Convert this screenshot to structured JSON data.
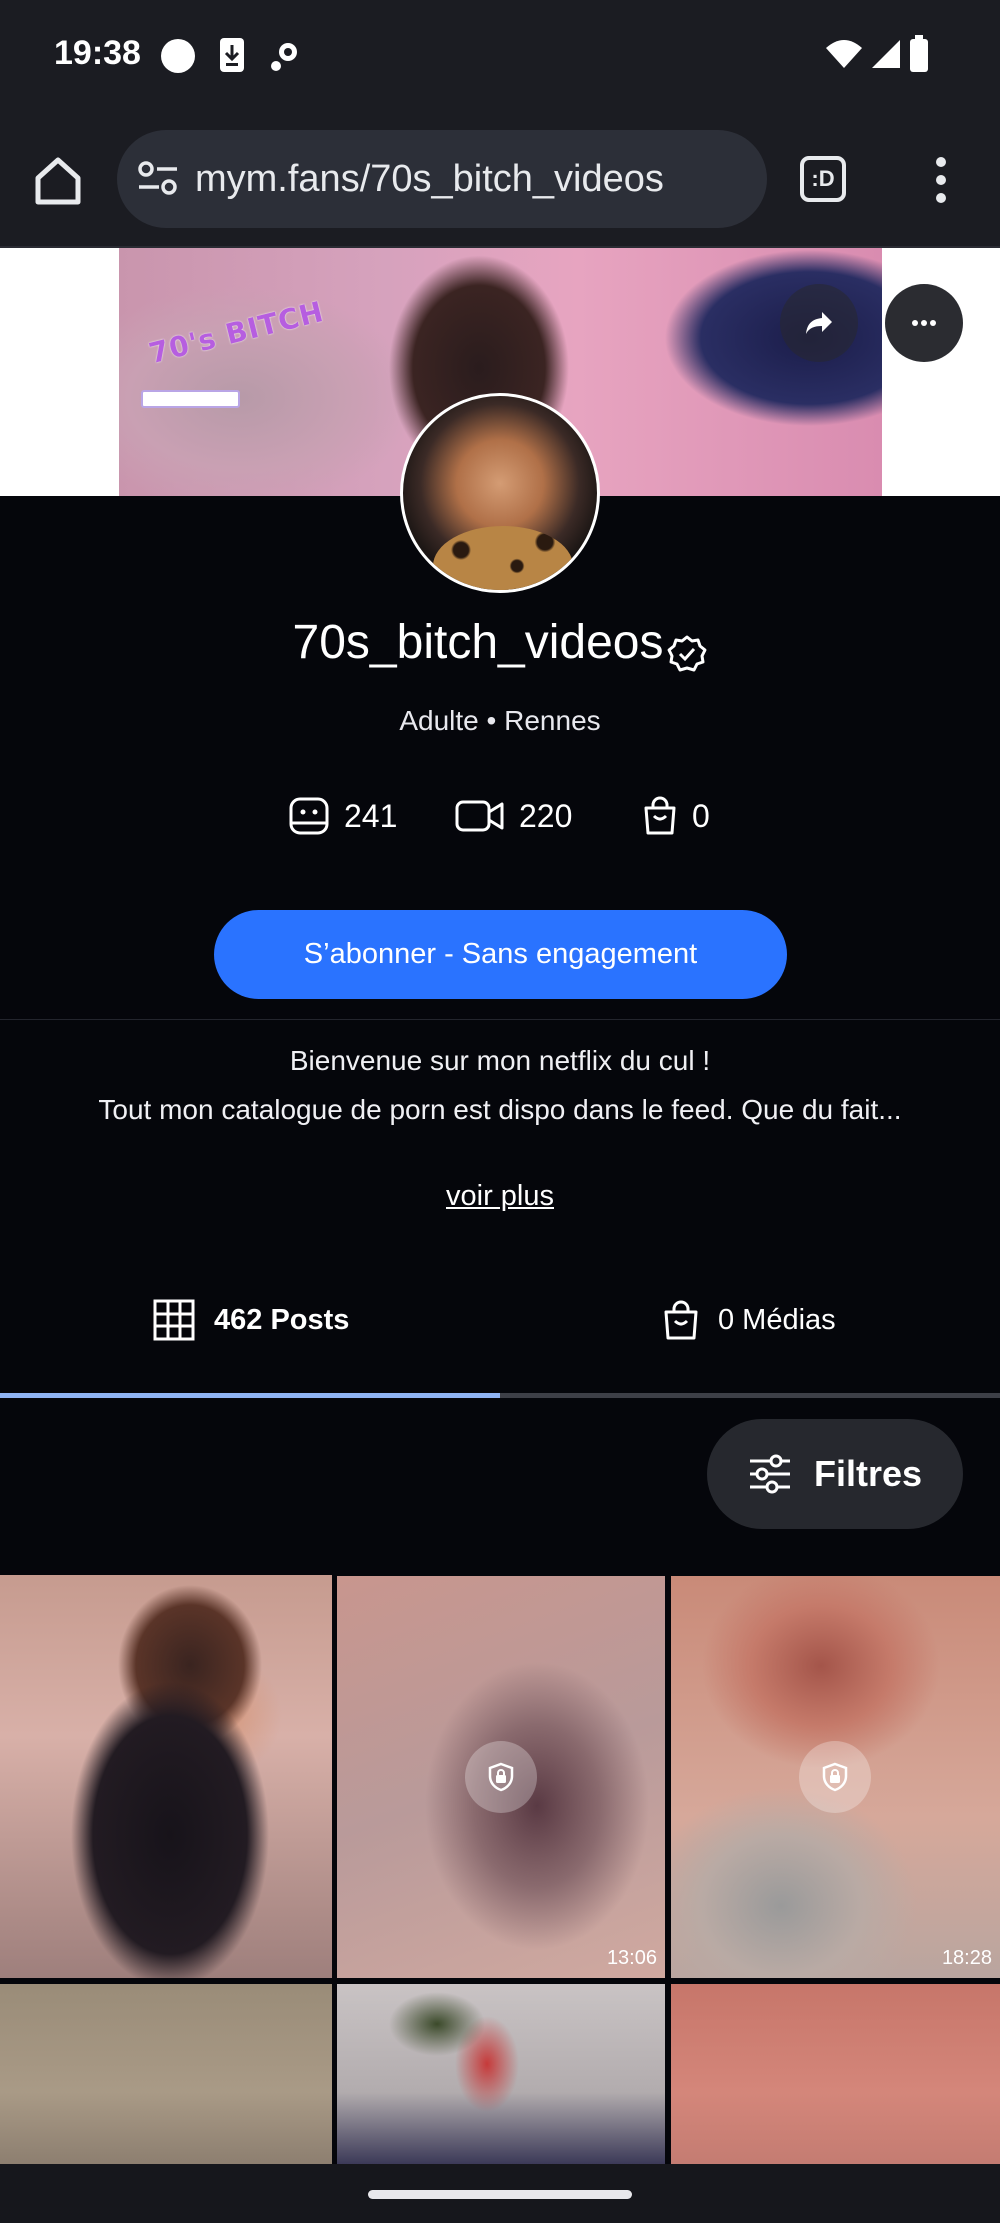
{
  "status_bar": {
    "time": "19:38"
  },
  "browser": {
    "url": "mym.fans/70s_bitch_videos",
    "tabs_label": ":D"
  },
  "banner": {
    "logo_text": "70's BITCH"
  },
  "profile": {
    "username": "70s_bitch_videos",
    "category": "Adulte",
    "location": "Rennes",
    "separator": "•",
    "stats": {
      "photos": "241",
      "videos": "220",
      "shop": "0"
    },
    "subscribe_label": "S’abonner - Sans engagement",
    "bio_line1": "Bienvenue sur mon netflix du cul !",
    "bio_line2": "Tout mon catalogue de porn est dispo dans le feed. Que du fait...",
    "see_more": "voir plus"
  },
  "tabs": {
    "posts_label": "462 Posts",
    "media_label": "0 Médias",
    "active": "posts"
  },
  "filters_label": "Filtres",
  "grid": {
    "row1": [
      {
        "locked": false,
        "duration": ""
      },
      {
        "locked": true,
        "duration": "13:06"
      },
      {
        "locked": true,
        "duration": "18:28"
      }
    ]
  },
  "colors": {
    "accent": "#2a73ff",
    "background": "#05060b",
    "tab_indicator": "#8fb3f3"
  }
}
